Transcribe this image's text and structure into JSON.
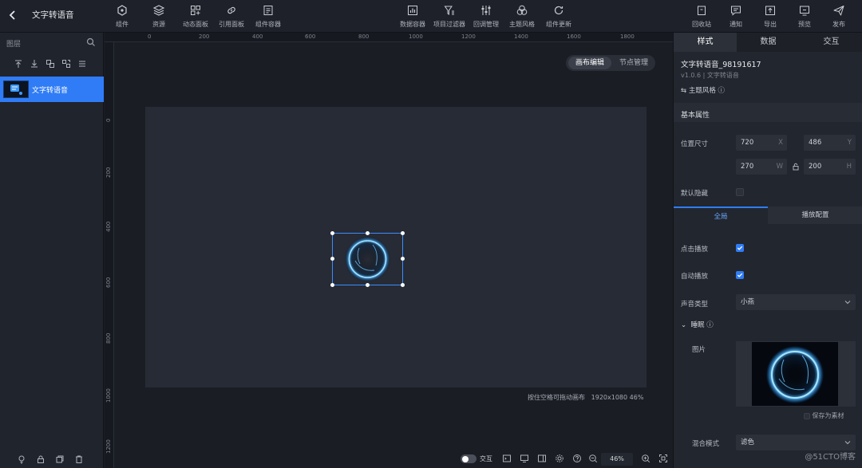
{
  "app": {
    "title": "文字转语音"
  },
  "toolbar": {
    "left": [
      {
        "label": "组件",
        "icon": "component-icon"
      },
      {
        "label": "资源",
        "icon": "layers-icon"
      },
      {
        "label": "动态面板",
        "icon": "dashboard-icon"
      },
      {
        "label": "引用面板",
        "icon": "link-icon"
      },
      {
        "label": "组件容器",
        "icon": "container-icon"
      }
    ],
    "center": [
      {
        "label": "数据容器",
        "icon": "chart-icon"
      },
      {
        "label": "项目过滤器",
        "icon": "filter-icon"
      },
      {
        "label": "回调管理",
        "icon": "sliders-icon"
      },
      {
        "label": "主题风格",
        "icon": "palette-icon"
      },
      {
        "label": "组件更新",
        "icon": "refresh-icon"
      }
    ],
    "right": [
      {
        "label": "回收站",
        "icon": "trash-icon"
      },
      {
        "label": "通知",
        "icon": "message-icon"
      },
      {
        "label": "导出",
        "icon": "export-icon"
      },
      {
        "label": "预览",
        "icon": "preview-icon"
      },
      {
        "label": "发布",
        "icon": "send-icon"
      }
    ]
  },
  "layers": {
    "title": "图层",
    "items": [
      {
        "name": "文字转语音",
        "selected": true
      }
    ]
  },
  "canvas": {
    "mode_tabs": [
      "画布编辑",
      "节点管理"
    ],
    "active_mode": "画布编辑",
    "hint": "按住空格可拖动画布",
    "size_info": "1920x1080 46%",
    "ruler_h": [
      "0",
      "200",
      "400",
      "600",
      "800",
      "1000",
      "1200",
      "1400",
      "1600",
      "1800"
    ],
    "ruler_v": [
      "0",
      "200",
      "400",
      "600",
      "800",
      "1000",
      "1200"
    ],
    "interaction_label": "交互",
    "zoom": "46%"
  },
  "properties": {
    "tabs": [
      "样式",
      "数据",
      "交互"
    ],
    "active_tab": "样式",
    "component_name": "文字转语音_98191617",
    "version_line": "v1.0.6 | 文字转语音",
    "theme_link": "主题风格",
    "basic_section": "基本属性",
    "position_label": "位置尺寸",
    "x": "720",
    "x_suffix": "X",
    "y": "486",
    "y_suffix": "Y",
    "w": "270",
    "w_suffix": "W",
    "h": "200",
    "h_suffix": "H",
    "default_hidden_label": "默认隐藏",
    "default_hidden": false,
    "subtabs": [
      "全局",
      "播放配置"
    ],
    "click_play_label": "点击播放",
    "click_play": true,
    "auto_play_label": "自动播放",
    "auto_play": true,
    "voice_type_label": "声音类型",
    "voice_type": "小燕",
    "sleep_label": "睡眠",
    "image_label": "图片",
    "save_asset": "保存为素材",
    "blend_label": "混合模式",
    "blend_mode": "滤色"
  },
  "watermark": "@51CTO博客",
  "colors": {
    "accent": "#2f7cf6",
    "glow": "#7fd0ff"
  }
}
